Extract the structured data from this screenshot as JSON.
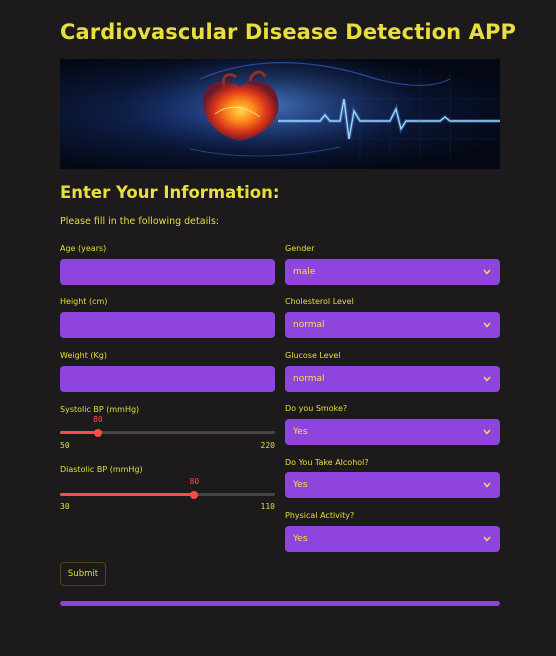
{
  "app": {
    "title": "Cardiovascular Disease Detection APP"
  },
  "banner": {
    "alt": "heart with ECG line"
  },
  "form": {
    "section_title": "Enter Your Information:",
    "subtitle": "Please fill in the following details:",
    "age": {
      "label": "Age (years)",
      "value": ""
    },
    "height": {
      "label": "Height (cm)",
      "value": ""
    },
    "weight": {
      "label": "Weight (Kg)",
      "value": ""
    },
    "systolic": {
      "label": "Systolic BP (mmHg)",
      "value": 80,
      "min": 50,
      "max": 220,
      "value_text": "80",
      "min_text": "50",
      "max_text": "220"
    },
    "diastolic": {
      "label": "Diastolic BP (mmHg)",
      "value": 80,
      "min": 30,
      "max": 110,
      "value_text": "80",
      "min_text": "30",
      "max_text": "110"
    },
    "gender": {
      "label": "Gender",
      "selected": "male"
    },
    "cholesterol": {
      "label": "Cholesterol Level",
      "selected": "normal"
    },
    "glucose": {
      "label": "Glucose Level",
      "selected": "normal"
    },
    "smoke": {
      "label": "Do you Smoke?",
      "selected": "Yes"
    },
    "alcohol": {
      "label": "Do You Take Alcohol?",
      "selected": "Yes"
    },
    "activity": {
      "label": "Physical Activity?",
      "selected": "Yes"
    },
    "submit_label": "Submit"
  },
  "progress": {
    "fraction": 1.0
  },
  "colors": {
    "background": "#1c1a1b",
    "accent_text": "#e8df3c",
    "field_bg": "#8e44dd",
    "slider": "#ff4b4b"
  },
  "icons": {
    "dropdown": "chevron-down-icon"
  }
}
